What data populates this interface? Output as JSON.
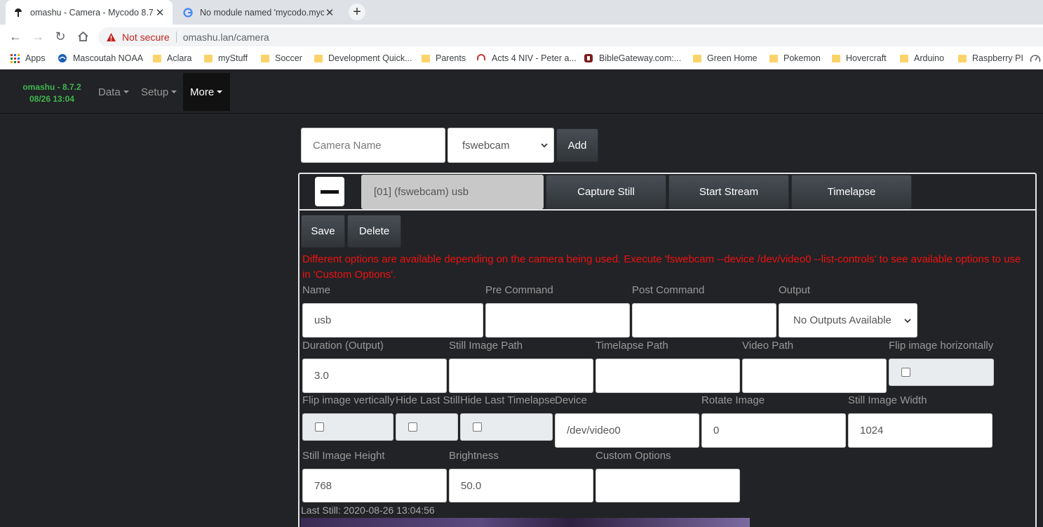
{
  "browser": {
    "tabs": [
      {
        "title": "omashu - Camera - Mycodo 8.7.2",
        "active": true
      },
      {
        "title": "No module named 'mycodo.mycodo",
        "active": false
      }
    ],
    "new_tab": "+",
    "security_label": "Not secure",
    "url": "omashu.lan/camera",
    "bookmarks": [
      "Apps",
      "Mascoutah NOAA",
      "Aclara",
      "myStuff",
      "Soccer",
      "Development Quick...",
      "Parents",
      "Acts 4 NIV - Peter a...",
      "BibleGateway.com:...",
      "Green Home",
      "Pokemon",
      "Hovercraft",
      "Arduino",
      "Raspberry PI"
    ]
  },
  "nav": {
    "brand_line1": "omashu - 8.7.2",
    "brand_line2": "08/26 13:04",
    "items": [
      "Data",
      "Setup",
      "More"
    ]
  },
  "add_camera": {
    "name_placeholder": "Camera Name",
    "library_selected": "fswebcam",
    "add_label": "Add"
  },
  "camera": {
    "header_label": "[01] (fswebcam) usb",
    "capture_label": "Capture Still",
    "stream_label": "Start Stream",
    "timelapse_label": "Timelapse",
    "save_label": "Save",
    "delete_label": "Delete",
    "notice": "Different options are available depending on the camera being used. Execute 'fswebcam --device /dev/video0 --list-controls' to see available options to use in 'Custom Options'.",
    "fields": {
      "name": {
        "label": "Name",
        "value": "usb"
      },
      "pre_command": {
        "label": "Pre Command",
        "value": ""
      },
      "post_command": {
        "label": "Post Command",
        "value": ""
      },
      "output": {
        "label": "Output",
        "value": "No Outputs Available"
      },
      "duration": {
        "label": "Duration (Output)",
        "value": "3.0"
      },
      "still_path": {
        "label": "Still Image Path",
        "value": ""
      },
      "timelapse_path": {
        "label": "Timelapse Path",
        "value": ""
      },
      "video_path": {
        "label": "Video Path",
        "value": ""
      },
      "flip_h": {
        "label": "Flip image horizontally",
        "checked": false
      },
      "flip_v": {
        "label": "Flip image vertically",
        "checked": false
      },
      "hide_still": {
        "label": "Hide Last Still",
        "checked": false
      },
      "hide_timelapse": {
        "label": "Hide Last Timelapse",
        "checked": false
      },
      "device": {
        "label": "Device",
        "value": "/dev/video0"
      },
      "rotate": {
        "label": "Rotate Image",
        "value": "0"
      },
      "width": {
        "label": "Still Image Width",
        "value": "1024"
      },
      "height": {
        "label": "Still Image Height",
        "value": "768"
      },
      "brightness": {
        "label": "Brightness",
        "value": "50.0"
      },
      "custom": {
        "label": "Custom Options",
        "value": ""
      }
    },
    "last_still": "Last Still: 2020-08-26 13:04:56"
  },
  "colors": {
    "brand_green": "#3fb54f",
    "notice_red": "#ee1111",
    "background": "#222326"
  }
}
